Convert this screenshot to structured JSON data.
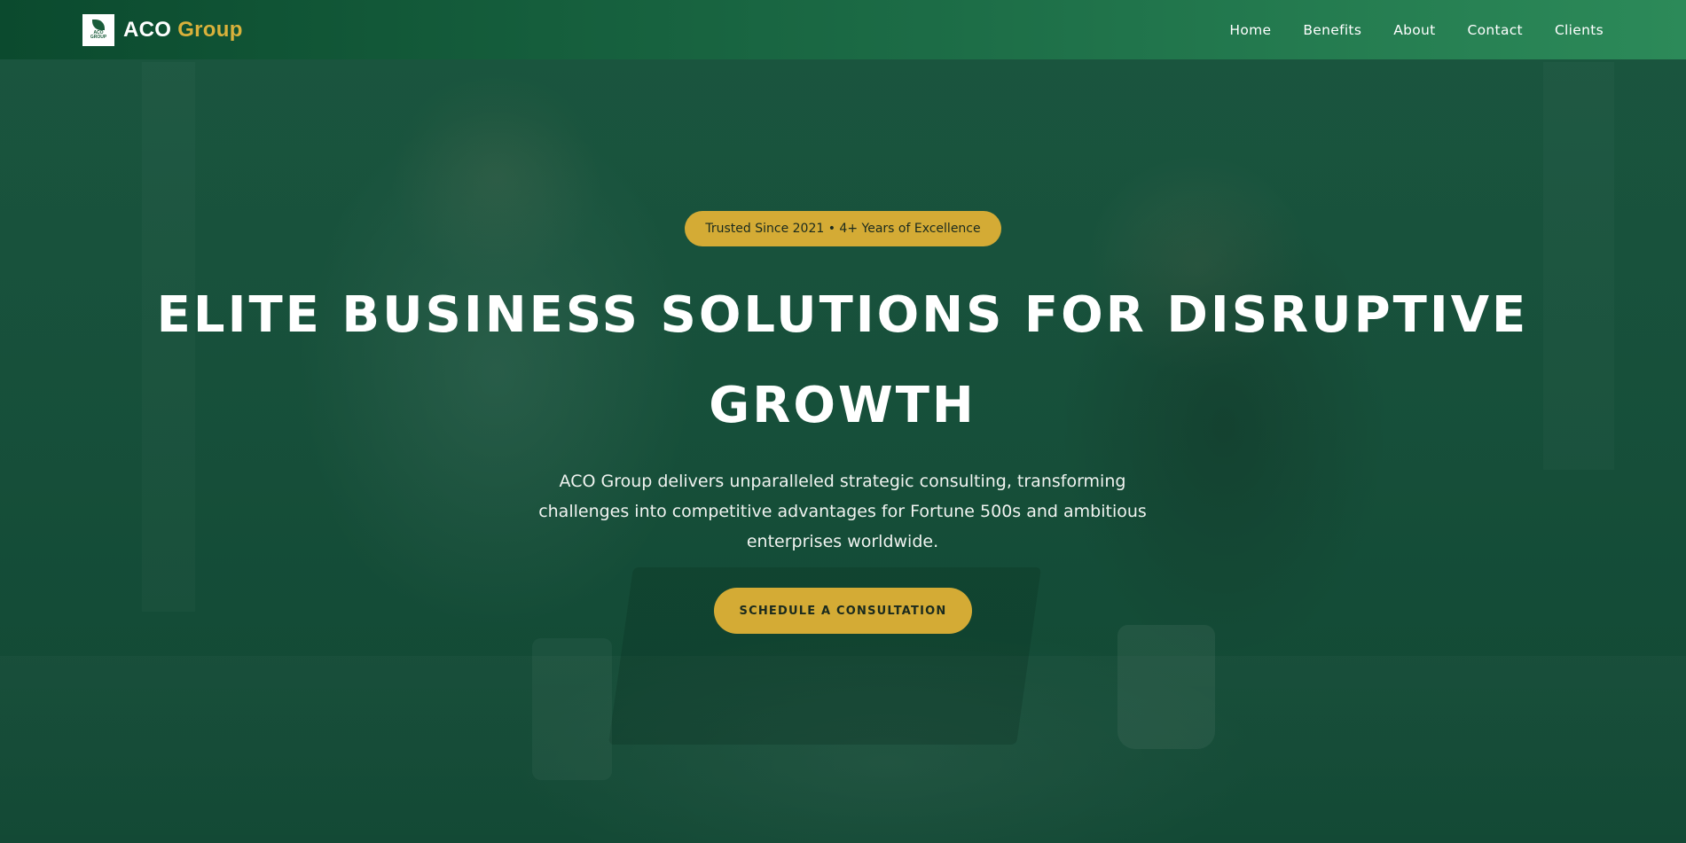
{
  "navbar": {
    "logo_text": [
      "ACO",
      "GROUP"
    ],
    "brand_primary": "ACO",
    "brand_accent": "Group",
    "links": [
      "Home",
      "Benefits",
      "About",
      "Contact",
      "Clients"
    ]
  },
  "hero": {
    "badge": "Trusted Since 2021 • 4+ Years of Excellence",
    "headline": "ELITE BUSINESS SOLUTIONS FOR DISRUPTIVE GROWTH",
    "subtext": "ACO Group delivers unparalleled strategic consulting, transforming challenges into competitive advantages for Fortune 500s and ambitious enterprises worldwide.",
    "cta_label": "SCHEDULE A CONSULTATION"
  },
  "colors": {
    "accent_gold": "#d4ab35",
    "nav_green_start": "#0b4a2e",
    "nav_green_end": "#2c8a59"
  }
}
